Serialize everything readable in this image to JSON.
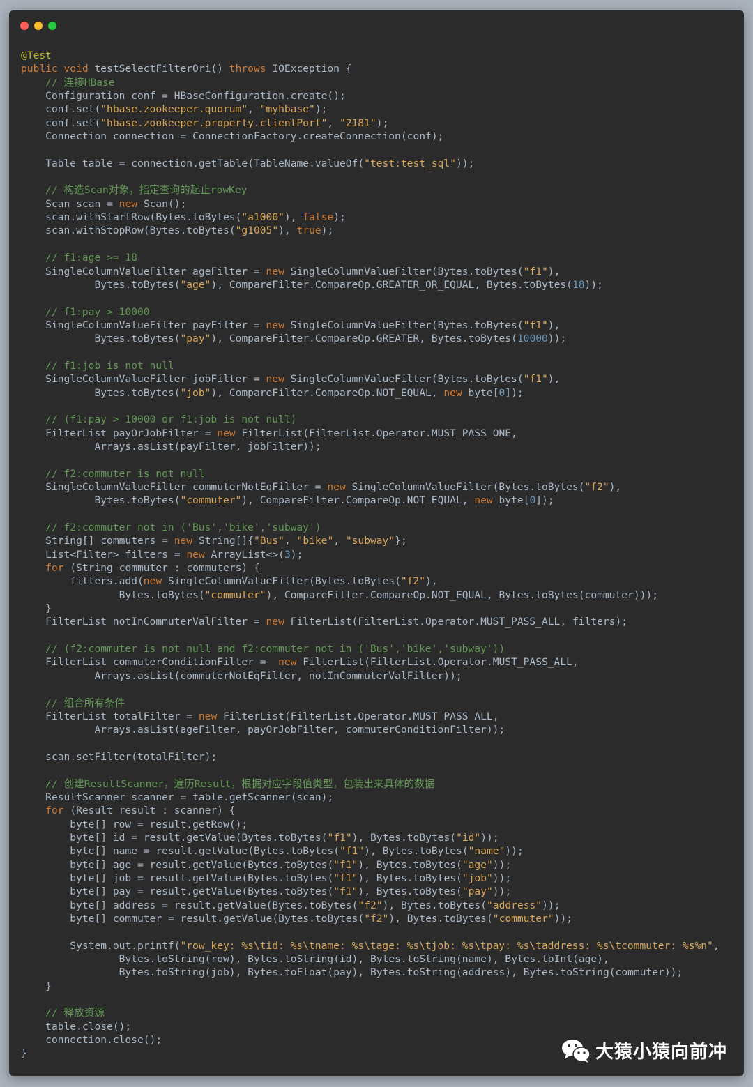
{
  "window": {
    "controls": [
      {
        "name": "close",
        "color": "#ff5f56"
      },
      {
        "name": "minimize",
        "color": "#ffbd2e"
      },
      {
        "name": "maximize",
        "color": "#27c93f"
      }
    ]
  },
  "code": {
    "lines": [
      "@Test",
      "public void testSelectFilterOri() throws IOException {",
      "    // 连接HBase",
      "    Configuration conf = HBaseConfiguration.create();",
      "    conf.set(\"hbase.zookeeper.quorum\", \"myhbase\");",
      "    conf.set(\"hbase.zookeeper.property.clientPort\", \"2181\");",
      "    Connection connection = ConnectionFactory.createConnection(conf);",
      "",
      "    Table table = connection.getTable(TableName.valueOf(\"test:test_sql\"));",
      "",
      "    // 构造Scan对象，指定查询的起止rowKey",
      "    Scan scan = new Scan();",
      "    scan.withStartRow(Bytes.toBytes(\"a1000\"), false);",
      "    scan.withStopRow(Bytes.toBytes(\"g1005\"), true);",
      "",
      "    // f1:age >= 18",
      "    SingleColumnValueFilter ageFilter = new SingleColumnValueFilter(Bytes.toBytes(\"f1\"),",
      "            Bytes.toBytes(\"age\"), CompareFilter.CompareOp.GREATER_OR_EQUAL, Bytes.toBytes(18));",
      "",
      "    // f1:pay > 10000",
      "    SingleColumnValueFilter payFilter = new SingleColumnValueFilter(Bytes.toBytes(\"f1\"),",
      "            Bytes.toBytes(\"pay\"), CompareFilter.CompareOp.GREATER, Bytes.toBytes(10000));",
      "",
      "    // f1:job is not null",
      "    SingleColumnValueFilter jobFilter = new SingleColumnValueFilter(Bytes.toBytes(\"f1\"),",
      "            Bytes.toBytes(\"job\"), CompareFilter.CompareOp.NOT_EQUAL, new byte[0]);",
      "",
      "    // (f1:pay > 10000 or f1:job is not null)",
      "    FilterList payOrJobFilter = new FilterList(FilterList.Operator.MUST_PASS_ONE,",
      "            Arrays.asList(payFilter, jobFilter));",
      "",
      "    // f2:commuter is not null",
      "    SingleColumnValueFilter commuterNotEqFilter = new SingleColumnValueFilter(Bytes.toBytes(\"f2\"),",
      "            Bytes.toBytes(\"commuter\"), CompareFilter.CompareOp.NOT_EQUAL, new byte[0]);",
      "",
      "    // f2:commuter not in ('Bus','bike','subway')",
      "    String[] commuters = new String[]{\"Bus\", \"bike\", \"subway\"};",
      "    List<Filter> filters = new ArrayList<>(3);",
      "    for (String commuter : commuters) {",
      "        filters.add(new SingleColumnValueFilter(Bytes.toBytes(\"f2\"),",
      "                Bytes.toBytes(\"commuter\"), CompareFilter.CompareOp.NOT_EQUAL, Bytes.toBytes(commuter)));",
      "    }",
      "    FilterList notInCommuterValFilter = new FilterList(FilterList.Operator.MUST_PASS_ALL, filters);",
      "",
      "    // (f2:commuter is not null and f2:commuter not in ('Bus','bike','subway'))",
      "    FilterList commuterConditionFilter =  new FilterList(FilterList.Operator.MUST_PASS_ALL,",
      "            Arrays.asList(commuterNotEqFilter, notInCommuterValFilter));",
      "",
      "    // 组合所有条件",
      "    FilterList totalFilter = new FilterList(FilterList.Operator.MUST_PASS_ALL,",
      "            Arrays.asList(ageFilter, payOrJobFilter, commuterConditionFilter));",
      "",
      "    scan.setFilter(totalFilter);",
      "",
      "    // 创建ResultScanner，遍历Result，根据对应字段值类型，包装出来具体的数据",
      "    ResultScanner scanner = table.getScanner(scan);",
      "    for (Result result : scanner) {",
      "        byte[] row = result.getRow();",
      "        byte[] id = result.getValue(Bytes.toBytes(\"f1\"), Bytes.toBytes(\"id\"));",
      "        byte[] name = result.getValue(Bytes.toBytes(\"f1\"), Bytes.toBytes(\"name\"));",
      "        byte[] age = result.getValue(Bytes.toBytes(\"f1\"), Bytes.toBytes(\"age\"));",
      "        byte[] job = result.getValue(Bytes.toBytes(\"f1\"), Bytes.toBytes(\"job\"));",
      "        byte[] pay = result.getValue(Bytes.toBytes(\"f1\"), Bytes.toBytes(\"pay\"));",
      "        byte[] address = result.getValue(Bytes.toBytes(\"f2\"), Bytes.toBytes(\"address\"));",
      "        byte[] commuter = result.getValue(Bytes.toBytes(\"f2\"), Bytes.toBytes(\"commuter\"));",
      "",
      "        System.out.printf(\"row_key: %s\\tid: %s\\tname: %s\\tage: %s\\tjob: %s\\tpay: %s\\taddress: %s\\tcommuter: %s%n\",",
      "                Bytes.toString(row), Bytes.toString(id), Bytes.toString(name), Bytes.toInt(age),",
      "                Bytes.toString(job), Bytes.toFloat(pay), Bytes.toString(address), Bytes.toString(commuter));",
      "    }",
      "",
      "    // 释放资源",
      "    table.close();",
      "    connection.close();",
      "}"
    ]
  },
  "watermark": {
    "icon": "wechat-icon",
    "text": "大猿小猿向前冲"
  },
  "colors": {
    "background": "#aab2bc",
    "editor": "#2b2b2b",
    "text": "#a9b7c6",
    "keyword": "#cc7832",
    "string": "#d8a657",
    "comment": "#629755",
    "number": "#6897bb",
    "annotation": "#bbb529"
  }
}
